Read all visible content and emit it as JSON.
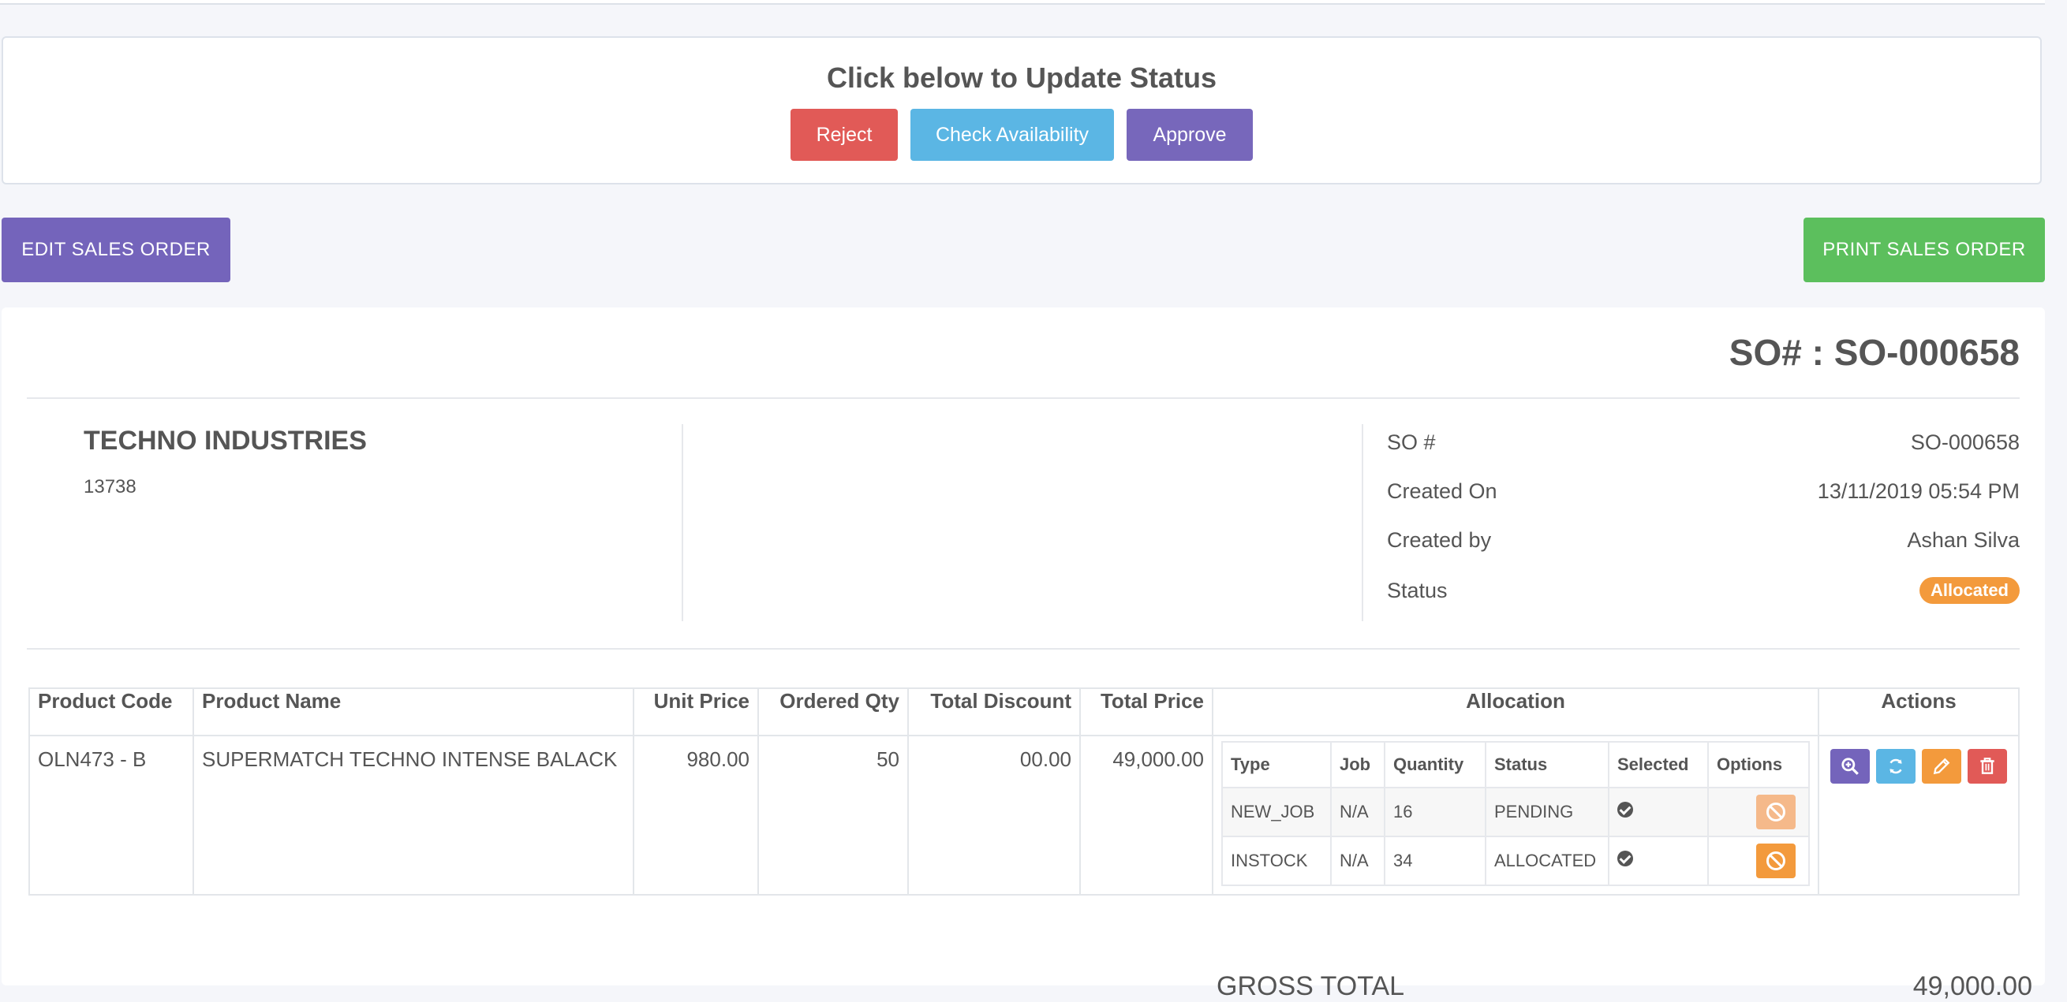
{
  "status_panel": {
    "title": "Click below to Update Status",
    "buttons": {
      "reject": "Reject",
      "check": "Check Availability",
      "approve": "Approve"
    }
  },
  "toolbar": {
    "edit_label": "EDIT SALES ORDER",
    "print_label": "PRINT SALES ORDER"
  },
  "order": {
    "heading": "SO# : SO-000658",
    "company_name": "TECHNO INDUSTRIES",
    "company_code": "13738",
    "meta": [
      {
        "label": "SO #",
        "value": "SO-000658"
      },
      {
        "label": "Created On",
        "value": "13/11/2019 05:54 PM"
      },
      {
        "label": "Created by",
        "value": "Ashan Silva"
      },
      {
        "label": "Status",
        "value": "Allocated"
      }
    ]
  },
  "table": {
    "headers": [
      "Product Code",
      "Product Name",
      "Unit Price",
      "Ordered Qty",
      "Total Discount",
      "Total Price",
      "Allocation",
      "Actions"
    ],
    "row": {
      "code": "OLN473 - B",
      "name": "SUPERMATCH TECHNO INTENSE BALACK",
      "unit_price": "980.00",
      "qty": "50",
      "discount": "00.00",
      "total": "49,000.00"
    },
    "allocation": {
      "headers": [
        "Type",
        "Job",
        "Quantity",
        "Status",
        "Selected",
        "Options"
      ],
      "rows": [
        {
          "type": "NEW_JOB",
          "job": "N/A",
          "quantity": "16",
          "status": "PENDING"
        },
        {
          "type": "INSTOCK",
          "job": "N/A",
          "quantity": "34",
          "status": "ALLOCATED"
        }
      ]
    }
  },
  "totals": {
    "gross_label": "GROSS TOTAL",
    "gross_value": "49,000.00"
  },
  "colors": {
    "reject": "#e15a57",
    "check": "#5bb6e4",
    "approve": "#7767bb",
    "edit": "#7464bb",
    "print": "#5cbf5d",
    "badge": "#f39a3c",
    "action_view": "#7464bb",
    "action_refresh": "#5bb6e4",
    "action_edit": "#f39a3c",
    "action_delete": "#e15a57"
  },
  "icons": [
    "zoom-in-icon",
    "refresh-icon",
    "pencil-icon",
    "trash-icon",
    "ban-icon",
    "check-circle-icon"
  ]
}
